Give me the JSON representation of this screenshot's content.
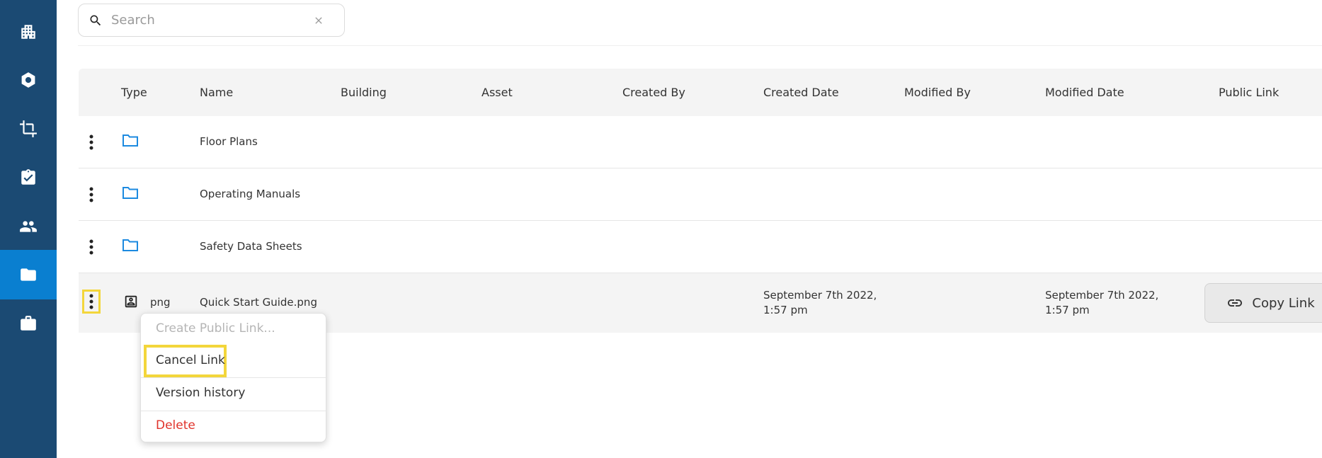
{
  "sidebar": {
    "items": [
      {
        "icon": "building-icon"
      },
      {
        "icon": "hexagon-icon"
      },
      {
        "icon": "crop-icon"
      },
      {
        "icon": "clipboard-check-icon"
      },
      {
        "icon": "people-icon"
      },
      {
        "icon": "folder-icon",
        "active": true
      },
      {
        "icon": "briefcase-icon"
      }
    ]
  },
  "search": {
    "placeholder": "Search"
  },
  "table": {
    "headers": {
      "type": "Type",
      "name": "Name",
      "building": "Building",
      "asset": "Asset",
      "created_by": "Created By",
      "created_date": "Created Date",
      "modified_by": "Modified By",
      "modified_date": "Modified Date",
      "public_link": "Public Link"
    },
    "rows": [
      {
        "type": "folder",
        "name": "Floor Plans"
      },
      {
        "type": "folder",
        "name": "Operating Manuals"
      },
      {
        "type": "folder",
        "name": "Safety Data Sheets"
      },
      {
        "type": "file",
        "type_label": "png",
        "name": "Quick Start Guide.png",
        "created_date_line1": "September 7th 2022,",
        "created_date_line2": "1:57 pm",
        "modified_date_line1": "September 7th 2022,",
        "modified_date_line2": "1:57 pm",
        "public_link_label": "Copy Link"
      }
    ]
  },
  "context_menu": {
    "items": [
      {
        "label": "Create Public Link...",
        "state": "disabled"
      },
      {
        "label": "Cancel Link",
        "state": "highlighted"
      },
      {
        "label": "Version history"
      },
      {
        "label": "Delete",
        "state": "danger",
        "color": "#e0332b"
      }
    ]
  },
  "colors": {
    "sidebar_bg": "#1b4a73",
    "sidebar_active": "#0a7fd0",
    "folder_icon": "#1c8ae0",
    "highlight": "#f3d63b"
  }
}
